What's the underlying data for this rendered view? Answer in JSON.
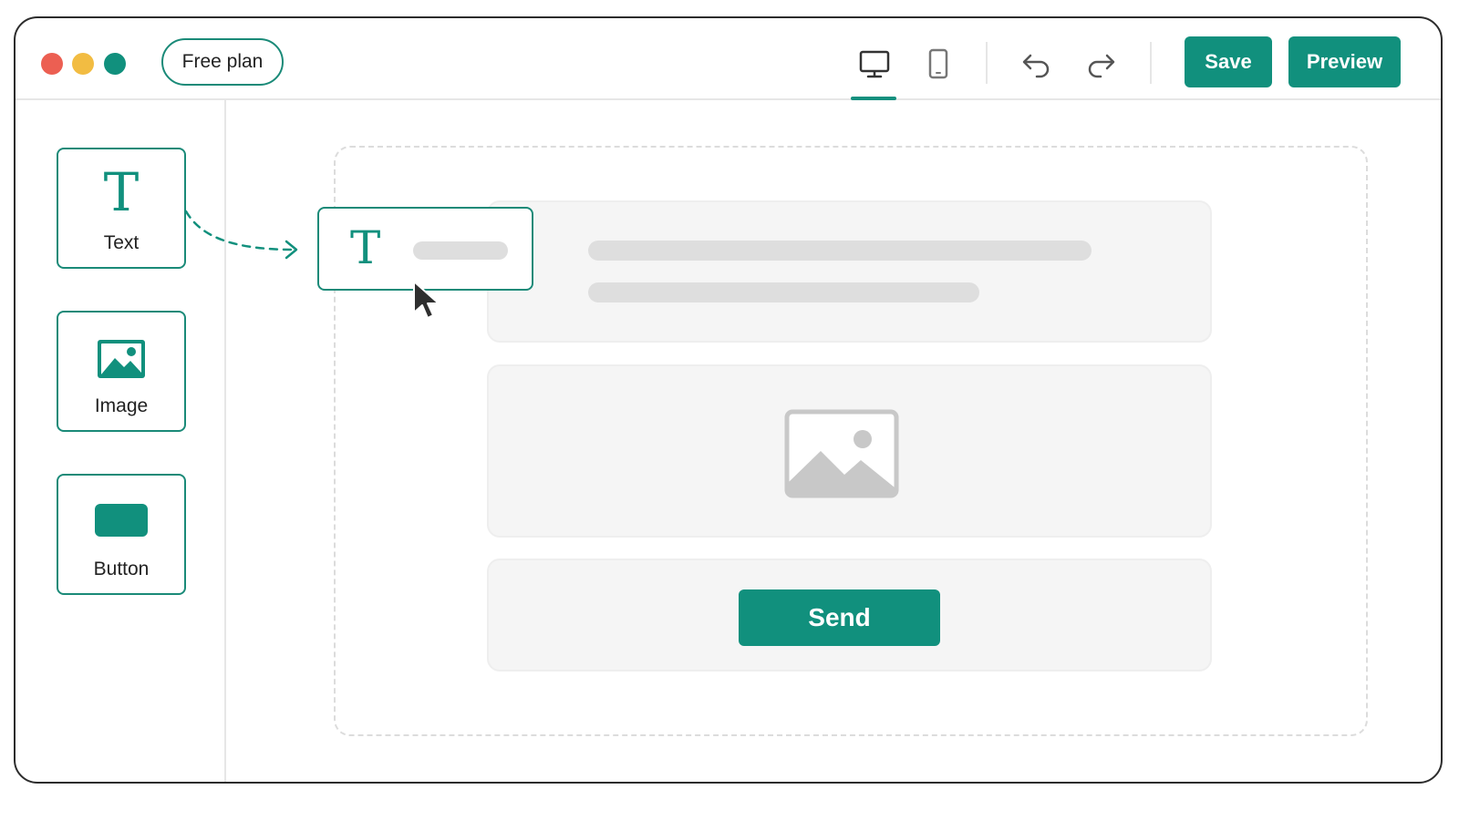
{
  "window": {
    "controls": [
      "close",
      "minimize",
      "maximize"
    ],
    "traffic_light_colors": [
      "#ec5f52",
      "#f2bc42",
      "#11907d"
    ]
  },
  "toolbar": {
    "plan_badge": "Free plan",
    "device_icons": [
      "desktop-icon",
      "mobile-icon"
    ],
    "active_device": "desktop",
    "history_icons": [
      "undo-icon",
      "redo-icon"
    ],
    "save_label": "Save",
    "preview_label": "Preview"
  },
  "sidebar": {
    "items": [
      {
        "label": "Text",
        "glyph": "T",
        "icon": "text-icon"
      },
      {
        "label": "Image",
        "icon": "image-icon"
      },
      {
        "label": "Button",
        "icon": "button-shape-icon"
      }
    ]
  },
  "canvas": {
    "drag_preview": {
      "glyph": "T",
      "icon": "text-icon"
    },
    "blocks": [
      {
        "type": "text-placeholder"
      },
      {
        "type": "image-placeholder",
        "icon": "image-placeholder-icon"
      },
      {
        "type": "button",
        "label": "Send"
      }
    ]
  },
  "colors": {
    "accent": "#11907d",
    "border_dark": "#2c2c2c",
    "placeholder_bg": "#f5f5f5",
    "skeleton": "#dedede"
  }
}
